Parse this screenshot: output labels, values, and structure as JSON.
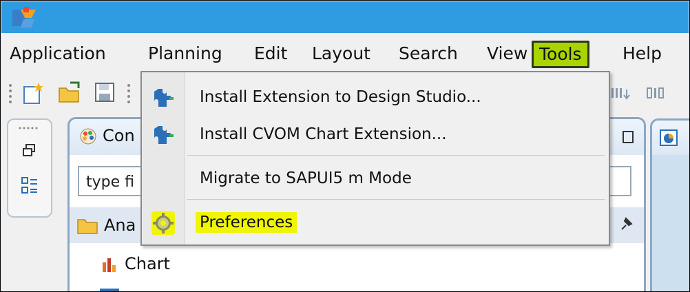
{
  "menubar": {
    "items": [
      "Application",
      "Planning",
      "Edit",
      "Layout",
      "Search",
      "View",
      "Tools",
      "Help"
    ]
  },
  "tools_menu": {
    "items": [
      {
        "label": "Install Extension to Design Studio...",
        "icon": "puzzle-icon"
      },
      {
        "label": "Install CVOM Chart Extension...",
        "icon": "puzzle-icon"
      },
      {
        "label": "Migrate to SAPUI5 m Mode",
        "icon": ""
      },
      {
        "label": "Preferences",
        "icon": "gear-icon"
      }
    ]
  },
  "panel": {
    "title": "Con",
    "filter_placeholder": "type fi",
    "folder_label": "Ana",
    "tree": [
      {
        "label": "Chart",
        "icon": "bar-chart-icon"
      }
    ]
  },
  "colors": {
    "titlebar": "#2f9be0",
    "tools_highlight": "#a9d400",
    "preferences_highlight": "#f0f500"
  }
}
